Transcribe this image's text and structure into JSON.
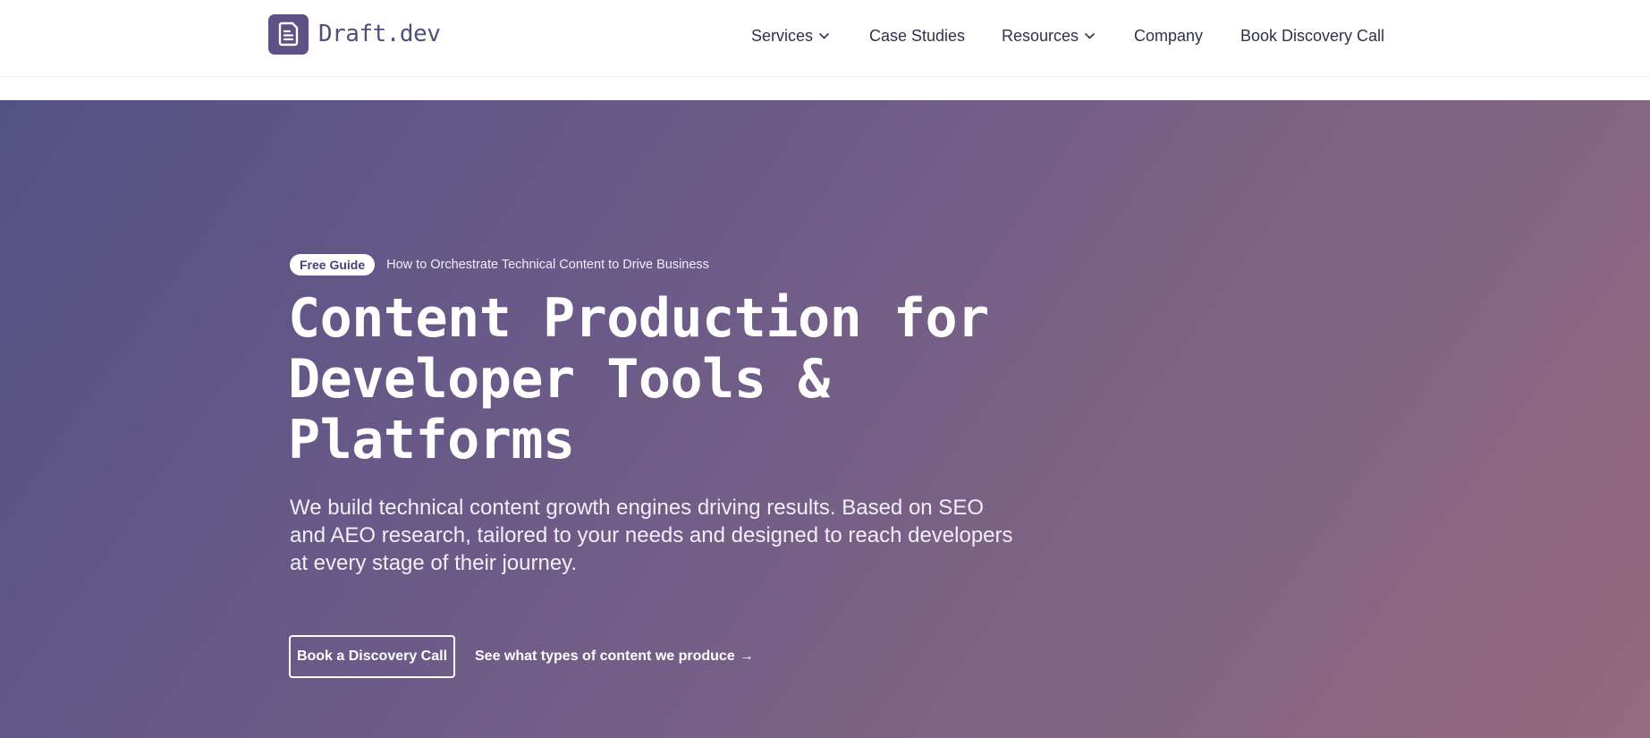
{
  "header": {
    "logo_text": "Draft.dev",
    "logo_icon": "document-icon",
    "nav": {
      "services": "Services",
      "case_studies": "Case Studies",
      "resources": "Resources",
      "company": "Company",
      "book_call": "Book Discovery Call"
    }
  },
  "hero": {
    "badge": "Free Guide",
    "badge_text": "How to Orchestrate Technical Content to Drive Business",
    "title_lines": [
      "Content Production for",
      "Developer Tools &",
      "Platforms"
    ],
    "description_lines": [
      "We build technical content growth engines driving results. Based on SEO",
      "and AEO research, tailored to your needs and designed to reach developers",
      "at every stage of their journey."
    ],
    "cta_primary": "Book a Discovery Call",
    "cta_secondary": "See what types of content we produce",
    "cta_secondary_arrow": "→"
  },
  "colors": {
    "brand": "#5e5186",
    "hero_gradient_start": "#545284",
    "hero_gradient_end": "#946a7e",
    "nav_text": "#2f3247"
  }
}
